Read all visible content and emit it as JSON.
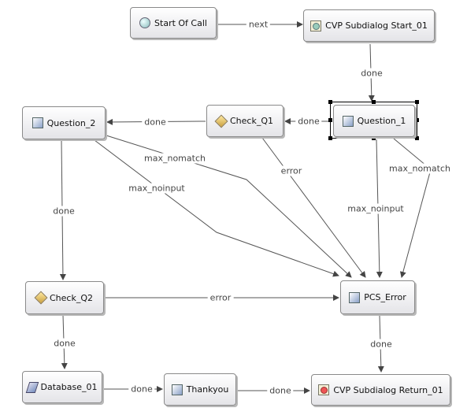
{
  "nodes": {
    "start_of_call": {
      "label": "Start Of Call",
      "icon": "start-circle-icon"
    },
    "subdialog_start": {
      "label": "CVP Subdialog Start_01",
      "icon": "subdialog-start-icon"
    },
    "question_1": {
      "label": "Question_1",
      "icon": "form-square-icon",
      "selected": true
    },
    "check_q1": {
      "label": "Check_Q1",
      "icon": "decision-diamond-icon"
    },
    "question_2": {
      "label": "Question_2",
      "icon": "form-square-icon"
    },
    "check_q2": {
      "label": "Check_Q2",
      "icon": "decision-diamond-icon"
    },
    "pcs_error": {
      "label": "PCS_Error",
      "icon": "form-square-icon"
    },
    "database_01": {
      "label": "Database_01",
      "icon": "database-icon"
    },
    "thankyou": {
      "label": "Thankyou",
      "icon": "form-square-icon"
    },
    "subdialog_return": {
      "label": "CVP Subdialog Return_01",
      "icon": "subdialog-return-icon"
    }
  },
  "edges": [
    {
      "from": "Start Of Call",
      "to": "CVP Subdialog Start_01",
      "label": "next"
    },
    {
      "from": "CVP Subdialog Start_01",
      "to": "Question_1",
      "label": "done"
    },
    {
      "from": "Question_1",
      "to": "Check_Q1",
      "label": "done"
    },
    {
      "from": "Check_Q1",
      "to": "Question_2",
      "label": "done"
    },
    {
      "from": "Question_2",
      "to": "PCS_Error",
      "label": "max_nomatch"
    },
    {
      "from": "Question_2",
      "to": "PCS_Error",
      "label": "max_noinput"
    },
    {
      "from": "Check_Q1",
      "to": "PCS_Error",
      "label": "error"
    },
    {
      "from": "Question_1",
      "to": "PCS_Error",
      "label": "max_noinput"
    },
    {
      "from": "Question_1",
      "to": "PCS_Error",
      "label": "max_nomatch"
    },
    {
      "from": "Question_2",
      "to": "Check_Q2",
      "label": "done"
    },
    {
      "from": "Check_Q2",
      "to": "PCS_Error",
      "label": "error"
    },
    {
      "from": "Check_Q2",
      "to": "Database_01",
      "label": "done"
    },
    {
      "from": "PCS_Error",
      "to": "CVP Subdialog Return_01",
      "label": "done"
    },
    {
      "from": "Database_01",
      "to": "Thankyou",
      "label": "done"
    },
    {
      "from": "Thankyou",
      "to": "CVP Subdialog Return_01",
      "label": "done"
    }
  ]
}
